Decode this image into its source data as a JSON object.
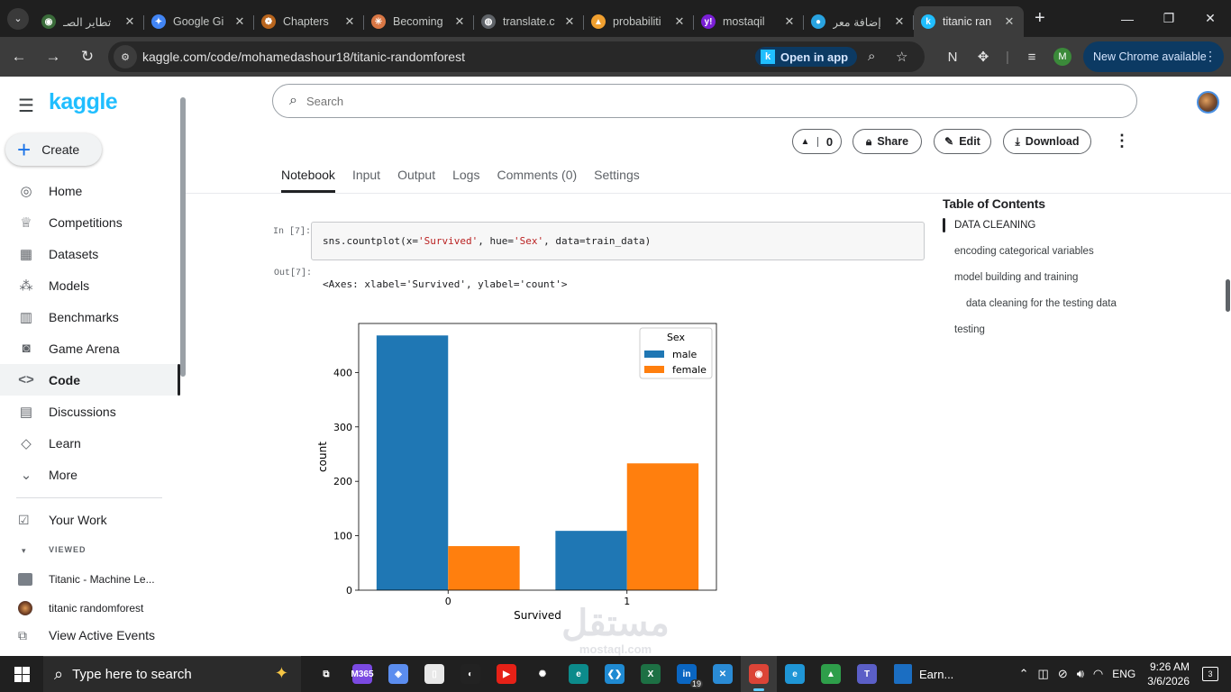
{
  "browser": {
    "tabs": [
      {
        "title": "تطاير الصـ",
        "favicon_color": "#3a6b3a",
        "glyph": "◉"
      },
      {
        "title": "Google Gi",
        "favicon_color": "#4285f4",
        "glyph": "✦"
      },
      {
        "title": "Chapters",
        "favicon_color": "#b8651e",
        "glyph": "❁"
      },
      {
        "title": "Becoming",
        "favicon_color": "#d97745",
        "glyph": "✳"
      },
      {
        "title": "translate.c",
        "favicon_color": "#5f6368",
        "glyph": "◍"
      },
      {
        "title": "probabiliti",
        "favicon_color": "#f0a030",
        "glyph": "▲"
      },
      {
        "title": "mostaqil",
        "favicon_color": "#7a1fd6",
        "glyph": "y!"
      },
      {
        "title": "إضافة معر",
        "favicon_color": "#29a3e0",
        "glyph": "●"
      },
      {
        "title": "titanic ran",
        "favicon_color": "#20beff",
        "glyph": "k"
      }
    ],
    "address": "kaggle.com/code/mohamedashour18/titanic-randomforest",
    "open_in_app": "Open in app",
    "open_in_app_badge": "k",
    "profile_initial": "M",
    "new_chrome": "New Chrome available"
  },
  "sidebar": {
    "logo": "kaggle",
    "create": "Create",
    "nav": [
      {
        "label": "Home",
        "icon": "compass-icon",
        "glyph": "◎"
      },
      {
        "label": "Competitions",
        "icon": "trophy-icon",
        "glyph": "♕"
      },
      {
        "label": "Datasets",
        "icon": "table-icon",
        "glyph": "▦"
      },
      {
        "label": "Models",
        "icon": "models-icon",
        "glyph": "⁂"
      },
      {
        "label": "Benchmarks",
        "icon": "bar-chart-icon",
        "glyph": "▥"
      },
      {
        "label": "Game Arena",
        "icon": "robot-icon",
        "glyph": "◙"
      },
      {
        "label": "Code",
        "icon": "code-icon",
        "glyph": "<>"
      },
      {
        "label": "Discussions",
        "icon": "comments-icon",
        "glyph": "▤"
      },
      {
        "label": "Learn",
        "icon": "graduation-icon",
        "glyph": "◇"
      },
      {
        "label": "More",
        "icon": "chevron-down-icon",
        "glyph": "⌄"
      }
    ],
    "active_index": 6,
    "your_work": "Your Work",
    "viewed_label": "VIEWED",
    "viewed": [
      {
        "label": "Titanic - Machine Le..."
      },
      {
        "label": "titanic randomforest"
      }
    ],
    "active_events": "View Active Events"
  },
  "header": {
    "search_placeholder": "Search",
    "vote_count": "0",
    "share": "Share",
    "edit": "Edit",
    "download": "Download"
  },
  "notebook_tabs": [
    "Notebook",
    "Input",
    "Output",
    "Logs",
    "Comments (0)",
    "Settings"
  ],
  "cell": {
    "in_label": "In [7]:",
    "out_label": "Out[7]:",
    "code_pre": "sns.countplot(x=",
    "code_s1": "'Survived'",
    "code_mid1": ", hue=",
    "code_s2": "'Sex'",
    "code_mid2": ", data=train_data)",
    "output_text": "<Axes: xlabel='Survived', ylabel='count'>"
  },
  "toc": {
    "title": "Table of Contents",
    "items": [
      {
        "label": "DATA CLEANING",
        "active": true
      },
      {
        "label": "encoding categorical variables"
      },
      {
        "label": "model building and training"
      },
      {
        "label": "data cleaning for the testing data",
        "indent": true
      },
      {
        "label": "testing"
      }
    ]
  },
  "chart_data": {
    "type": "bar",
    "categories": [
      "0",
      "1"
    ],
    "series": [
      {
        "name": "male",
        "values": [
          468,
          109
        ],
        "color": "#1f77b4"
      },
      {
        "name": "female",
        "values": [
          81,
          233
        ],
        "color": "#ff7f0e"
      }
    ],
    "xlabel": "Survived",
    "ylabel": "count",
    "ylim": [
      0,
      490
    ],
    "yticks": [
      0,
      100,
      200,
      300,
      400
    ],
    "legend_title": "Sex",
    "legend_position": "top-right",
    "grid": false
  },
  "watermark": {
    "main": "مستقل",
    "sub": "mostaql.com"
  },
  "taskbar": {
    "search_placeholder": "Type here to search",
    "icons": [
      {
        "name": "task-view-icon",
        "glyph": "⧉",
        "color": "transparent"
      },
      {
        "name": "m365-icon",
        "glyph": "M365",
        "color": "#7b4ae2"
      },
      {
        "name": "copilot-icon",
        "glyph": "◈",
        "color": "#5b8def"
      },
      {
        "name": "file-icon",
        "glyph": "▯",
        "color": "#e8e8e8"
      },
      {
        "name": "app-icon",
        "glyph": "◐",
        "color": "#222"
      },
      {
        "name": "youtube-icon",
        "glyph": "▶",
        "color": "#e62117"
      },
      {
        "name": "chatgpt-icon",
        "glyph": "✺",
        "color": "transparent"
      },
      {
        "name": "edge-dev-icon",
        "glyph": "e",
        "color": "#0c8b8b"
      },
      {
        "name": "vscode-icon",
        "glyph": "❮❯",
        "color": "#1f8ad2"
      },
      {
        "name": "excel-icon",
        "glyph": "X",
        "color": "#1d7044"
      },
      {
        "name": "linkedin-icon",
        "glyph": "in",
        "color": "#0a66c2"
      },
      {
        "name": "vscode-2-icon",
        "glyph": "✕",
        "color": "#2a8bd5"
      },
      {
        "name": "chrome-icon",
        "glyph": "◉",
        "color": "#db4437"
      },
      {
        "name": "edge-icon",
        "glyph": "e",
        "color": "#1f96d6"
      },
      {
        "name": "drive-icon",
        "glyph": "▲",
        "color": "#2e9e4a"
      },
      {
        "name": "teams-icon",
        "glyph": "T",
        "color": "#5b5fc7"
      }
    ],
    "badge_linkedin": "19",
    "earn_label": "Earn...",
    "lang": "ENG",
    "time": "9:26 AM",
    "date": "3/6/2026",
    "notifications": "3"
  }
}
